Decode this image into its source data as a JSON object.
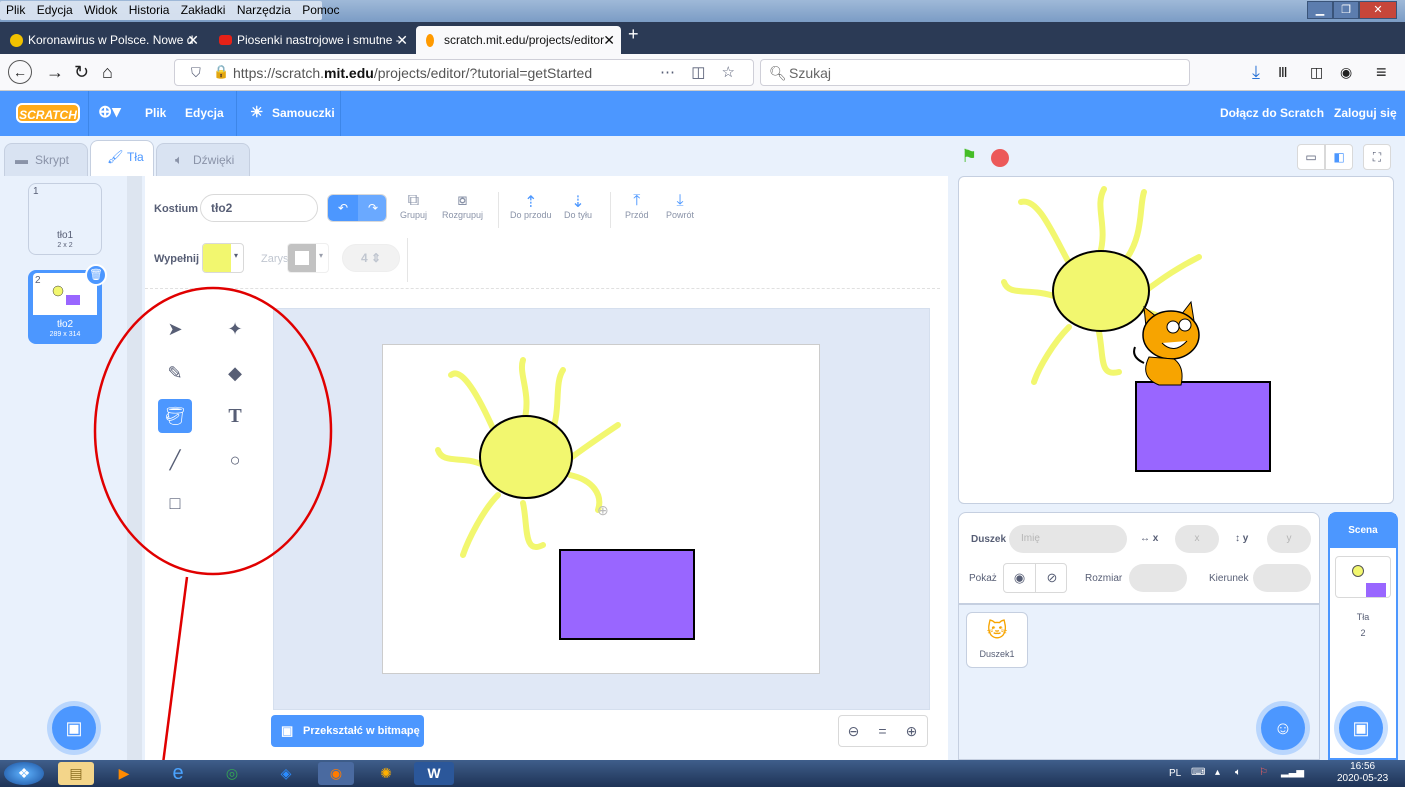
{
  "menubar": {
    "items": [
      "Plik",
      "Edycja",
      "Widok",
      "Historia",
      "Zakładki",
      "Narzędzia",
      "Pomoc"
    ]
  },
  "tabs": [
    {
      "title": "Koronawirus w Polsce. Nowe d",
      "icon_color": "#f2c200"
    },
    {
      "title": "Piosenki nastrojowe i smutne -",
      "icon_color": "#e62117"
    },
    {
      "title": "scratch.mit.edu/projects/editor",
      "icon_color": "#ff9a00"
    }
  ],
  "nav": {
    "url_prefix": "https://scratch.",
    "url_domain": "mit.edu",
    "url_path": "/projects/editor/?tutorial=getStarted",
    "search_placeholder": "Szukaj"
  },
  "header": {
    "logo": "SCRATCH",
    "file": "Plik",
    "edit": "Edycja",
    "tutorials": "Samouczki",
    "join": "Dołącz do Scratch",
    "signin": "Zaloguj się"
  },
  "editor_tabs": {
    "code": "Skrypt",
    "backdrops": "Tła",
    "sounds": "Dźwięki"
  },
  "costumes": [
    {
      "num": "1",
      "name": "tło1",
      "size": "2 x 2"
    },
    {
      "num": "2",
      "name": "tło2",
      "size": "289 x 314"
    }
  ],
  "paint": {
    "costume_label": "Kostium",
    "costume_name": "tło2",
    "group": "Grupuj",
    "ungroup": "Rozgrupuj",
    "forward": "Do przodu",
    "backward": "Do tyłu",
    "front": "Przód",
    "back": "Powrót",
    "fill_label": "Wypełnij",
    "outline_label": "Zarys",
    "outline_size": "4",
    "fill_color": "#f2f76f",
    "bitmap_button": "Przekształć w bitmapę"
  },
  "sprite_info": {
    "sprite_label": "Duszek",
    "name_placeholder": "Imię",
    "x_label": "x",
    "x_placeholder": "x",
    "y_label": "y",
    "y_placeholder": "y",
    "show_label": "Pokaż",
    "size_label": "Rozmiar",
    "direction_label": "Kierunek"
  },
  "sprites": [
    {
      "name": "Duszek1"
    }
  ],
  "stage_panel": {
    "title": "Scena",
    "backdrops_label": "Tła",
    "backdrops_count": "2"
  },
  "tray": {
    "lang": "PL",
    "time": "16:56",
    "date": "2020-05-23"
  },
  "colors": {
    "accent": "#4c97ff",
    "sun": "#f2f76f",
    "rect": "#9966ff",
    "annotation": "#e00000"
  }
}
